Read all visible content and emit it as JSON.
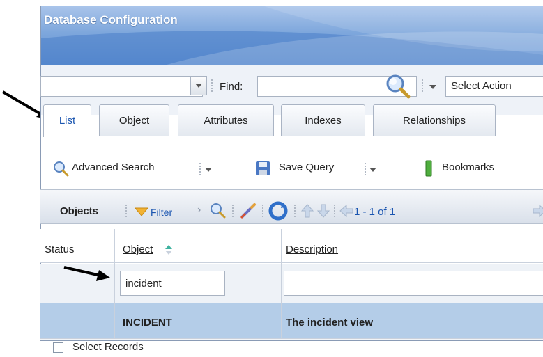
{
  "window": {
    "title": "Database Configuration"
  },
  "toolbar": {
    "find_label": "Find:",
    "find_value": "",
    "select_action": "Select Action"
  },
  "tabs": [
    {
      "label": "List",
      "active": true
    },
    {
      "label": "Object",
      "active": false
    },
    {
      "label": "Attributes",
      "active": false
    },
    {
      "label": "Indexes",
      "active": false
    },
    {
      "label": "Relationships",
      "active": false
    }
  ],
  "actions": {
    "advanced_search": "Advanced Search",
    "save_query": "Save Query",
    "bookmarks": "Bookmarks"
  },
  "list_toolbar": {
    "title": "Objects",
    "filter": "Filter",
    "count": "1 - 1 of 1"
  },
  "table": {
    "columns": [
      "Status",
      "Object",
      "Description"
    ],
    "filter_values": {
      "object": "incident",
      "description": ""
    },
    "rows": [
      {
        "status": "",
        "object": "INCIDENT",
        "description": "The incident view"
      }
    ],
    "select_records": "Select Records"
  },
  "colors": {
    "accent": "#1a55b0",
    "title_gradient": "#7ea7dc",
    "selected_row": "#b4cde8"
  }
}
